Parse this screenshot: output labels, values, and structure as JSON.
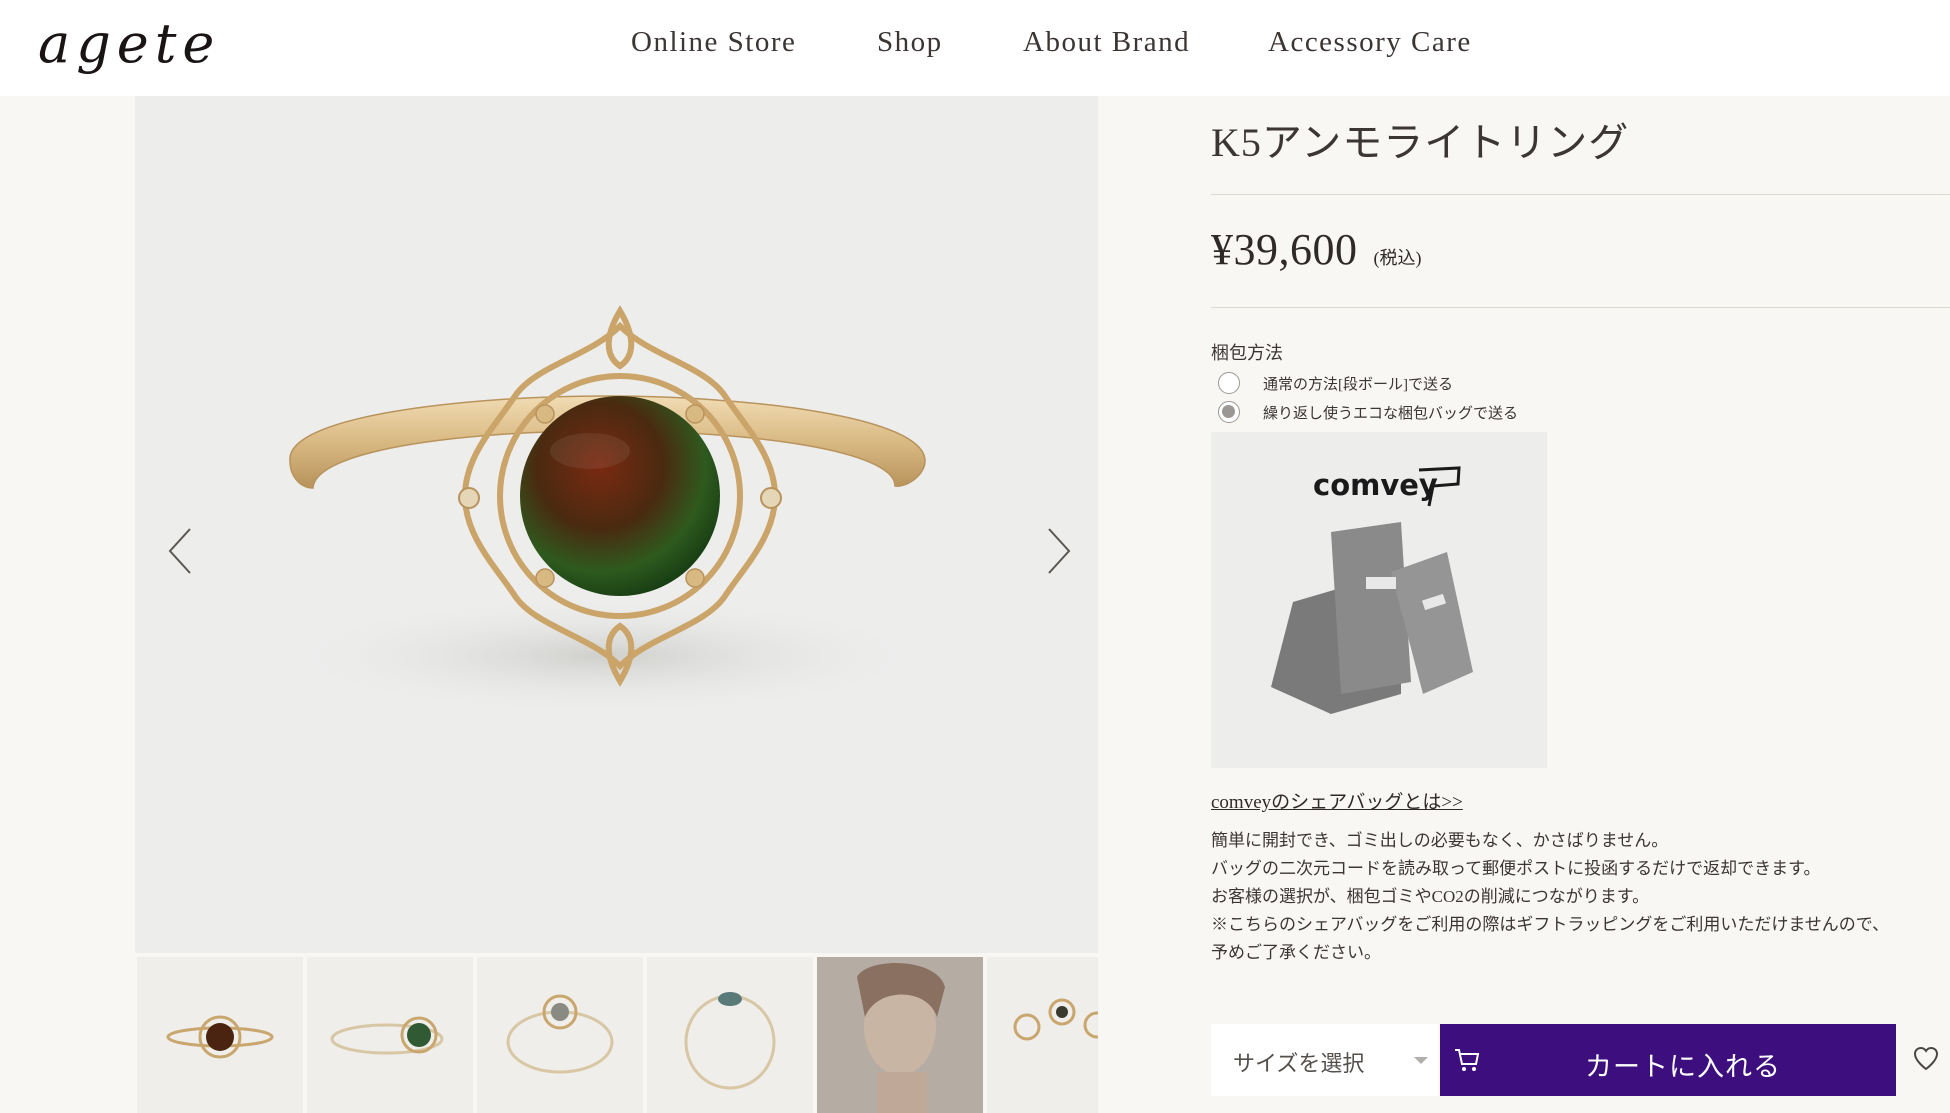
{
  "brand": {
    "logo_text": "agete"
  },
  "nav": [
    {
      "label": "Online Store"
    },
    {
      "label": "Shop"
    },
    {
      "label": "About Brand"
    },
    {
      "label": "Accessory Care"
    }
  ],
  "gallery": {
    "prev_icon": "chevron-left-icon",
    "next_icon": "chevron-right-icon",
    "thumbnail_count_visible": 6
  },
  "product": {
    "title": "K5アンモライトリング",
    "price": "¥39,600",
    "tax_note": "(税込)"
  },
  "packaging": {
    "label": "梱包方法",
    "options": [
      {
        "label": "通常の方法[段ボール]で送る",
        "selected": false
      },
      {
        "label": "繰り返し使うエコな梱包バッグで送る",
        "selected": true
      }
    ],
    "image_logo_text": "comvey",
    "link_text": "comveyのシェアバッグとは>>",
    "description": [
      "簡単に開封でき、ゴミ出しの必要もなく、かさばりません。",
      "バッグの二次元コードを読み取って郵便ポストに投函するだけで返却できます。",
      "お客様の選択が、梱包ゴミやCO2の削減につながります。",
      "※こちらのシェアバッグをご利用の際はギフトラッピングをご利用いただけませんので、",
      "予めご了承ください。"
    ]
  },
  "purchase": {
    "size_placeholder": "サイズを選択",
    "cart_label": "カートに入れる",
    "cart_icon": "cart-icon",
    "favorite_icon": "heart-icon"
  },
  "colors": {
    "accent": "#3d0f7e",
    "background": "#f8f7f4",
    "header": "#ffffff"
  }
}
